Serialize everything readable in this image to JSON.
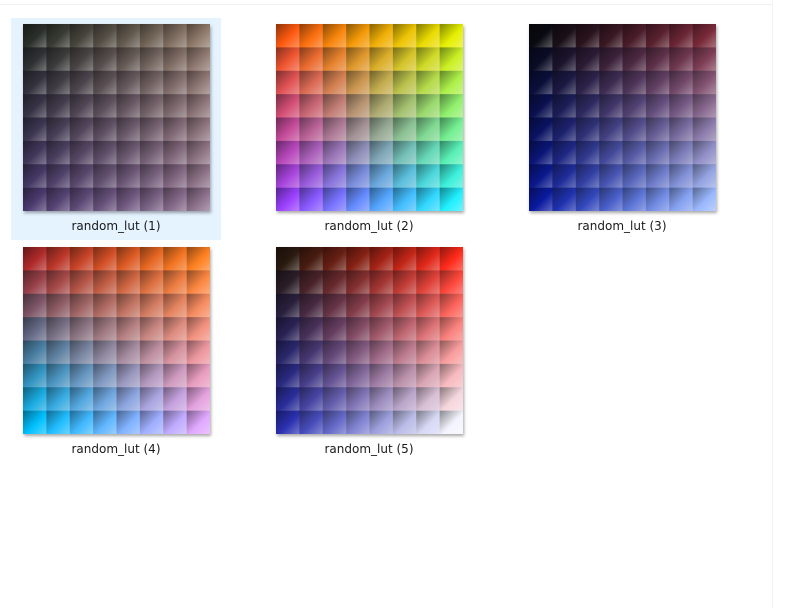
{
  "view": {
    "items": [
      {
        "label": "random_lut (1)",
        "selected": true,
        "icon": "lut-thumbnail-icon",
        "tint": [
          "#2a2f2a",
          "#8f7a6a",
          "#4a3a6e",
          "#8b6f8b"
        ]
      },
      {
        "label": "random_lut (2)",
        "selected": false,
        "icon": "lut-thumbnail-icon",
        "tint": [
          "#ff5a10",
          "#e6f000",
          "#9a40ff",
          "#20f0ff"
        ]
      },
      {
        "label": "random_lut (3)",
        "selected": false,
        "icon": "lut-thumbnail-icon",
        "tint": [
          "#0a0a12",
          "#7a2a3a",
          "#0a1aa0",
          "#9ab8ff"
        ]
      },
      {
        "label": "random_lut (4)",
        "selected": false,
        "icon": "lut-thumbnail-icon",
        "tint": [
          "#b02a2a",
          "#ff8020",
          "#00c0ff",
          "#e0a8ff"
        ]
      },
      {
        "label": "random_lut (5)",
        "selected": false,
        "icon": "lut-thumbnail-icon",
        "tint": [
          "#2a1a10",
          "#ff2a1a",
          "#2a30b0",
          "#f4f4ff"
        ]
      }
    ]
  }
}
